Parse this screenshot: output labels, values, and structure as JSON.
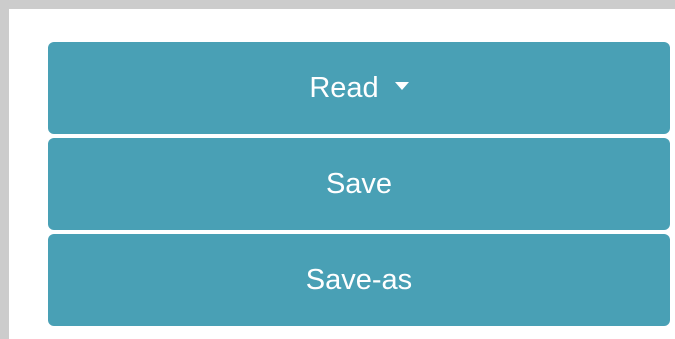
{
  "menu": {
    "read_label": "Read",
    "save_label": "Save",
    "save_as_label": "Save-as"
  },
  "style": {
    "button_color": "#49a0b5",
    "text_color": "#ffffff",
    "frame_color": "#cccccc"
  },
  "icons": {
    "dropdown": "caret-down-icon"
  }
}
